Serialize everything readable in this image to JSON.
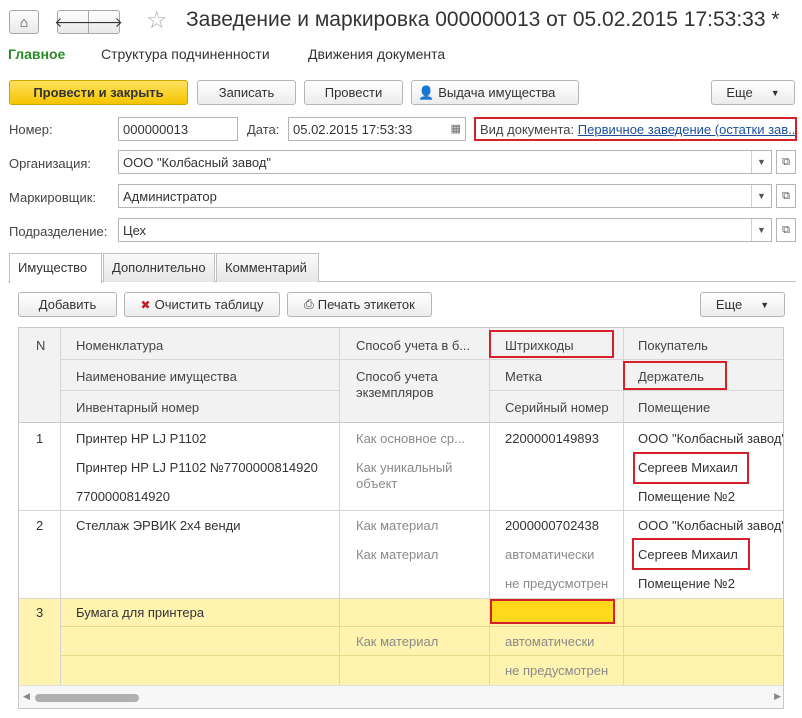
{
  "window": {
    "title": "Заведение и маркировка 000000013 от 05.02.2015 17:53:33 *"
  },
  "sections": [
    "Главное",
    "Структура подчиненности",
    "Движения документа"
  ],
  "toolbar": {
    "post_close": "Провести и закрыть",
    "save": "Записать",
    "post": "Провести",
    "issue": "Выдача имущества",
    "more": "Еще"
  },
  "form": {
    "number_label": "Номер:",
    "number_value": "000000013",
    "date_label": "Дата:",
    "date_value": "05.02.2015 17:53:33",
    "doc_type_label": "Вид документа:",
    "doc_type_value": "Первичное заведение (остатки зав...",
    "org_label": "Организация:",
    "org_value": "ООО \"Колбасный завод\"",
    "marker_label": "Маркировщик:",
    "marker_value": "Администратор",
    "dept_label": "Подразделение:",
    "dept_value": "Цех"
  },
  "tabs": [
    "Имущество",
    "Дополнительно",
    "Комментарий"
  ],
  "table_toolbar": {
    "add": "Добавить",
    "clear": "Очистить таблицу",
    "print": "Печать этикеток",
    "more": "Еще"
  },
  "table": {
    "headers": {
      "n": "N",
      "nomenclature": "Номенклатура",
      "property_name": "Наименование имущества",
      "inventory_no": "Инвентарный номер",
      "accounting_method": "Способ учета в б...",
      "copy_accounting_1": "Способ учета",
      "copy_accounting_2": "экземпляров",
      "barcodes": "Штрихкоды",
      "mark": "Метка",
      "serial": "Серийный номер",
      "buyer": "Покупатель",
      "holder": "Держатель",
      "room": "Помещение"
    },
    "rows": [
      {
        "n": "1",
        "nomenclature": "Принтер HP LJ P1102",
        "property_name": "Принтер HP LJ P1102 №7700000814920",
        "inventory_no": "7700000814920",
        "accounting_method": "Как основное ср...",
        "copy_accounting_1": "Как уникальный",
        "copy_accounting_2": "объект",
        "barcode": "2200000149893",
        "buyer": "ООО \"Колбасный завод\"",
        "holder": "Сергеев Михаил",
        "room": "Помещение №2"
      },
      {
        "n": "2",
        "nomenclature": "Стеллаж ЭРВИК 2х4 венди",
        "accounting_method": "Как материал",
        "copy_accounting_1": "Как материал",
        "barcode": "2000000702438",
        "mark": "автоматически",
        "serial": "не предусмотрен",
        "buyer": "ООО \"Колбасный завод\"",
        "holder": "Сергеев Михаил",
        "room": "Помещение №2"
      },
      {
        "n": "3",
        "nomenclature": "Бумага для принтера",
        "copy_accounting_1": "Как материал",
        "mark": "автоматически",
        "serial": "не предусмотрен"
      }
    ]
  },
  "colors": {
    "accent_green": "#2a8c2a",
    "primary_yellow": "#f5c400",
    "highlight_red": "#d6202a",
    "selected_row": "#fff3b0",
    "barcode_cell": "#ffd91a"
  },
  "icons": [
    "home-icon",
    "back-arrow-icon",
    "forward-arrow-icon",
    "star-icon",
    "calendar-icon",
    "dropdown-icon",
    "open-icon",
    "clear-table-icon",
    "print-icon",
    "user-icon"
  ]
}
